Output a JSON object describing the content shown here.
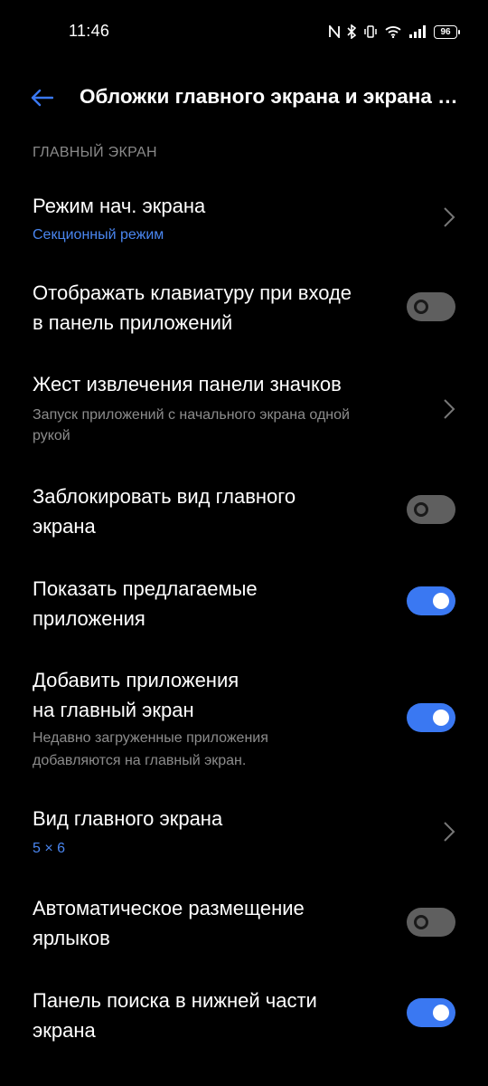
{
  "status_bar": {
    "time": "11:46",
    "battery": "96",
    "icons": [
      "nfc-icon",
      "bluetooth-icon",
      "vibrate-icon",
      "wifi-icon",
      "signal-icon",
      "battery-icon"
    ]
  },
  "header": {
    "title": "Обложки главного экрана и экрана блокировки"
  },
  "section": {
    "label": "ГЛАВНЫЙ ЭКРАН"
  },
  "settings": [
    {
      "title": "Режим нач. экрана",
      "subtitle": "Секционный режим",
      "control": "chevron"
    },
    {
      "title_lines": [
        "Отображать клавиатуру при входе",
        "в панель приложений"
      ],
      "control": "toggle",
      "state": "off"
    },
    {
      "title": "Жест извлечения панели значков",
      "subtitle_lines": [
        "Запуск приложений с начального экрана одной",
        "рукой"
      ],
      "control": "chevron"
    },
    {
      "title_lines": [
        "Заблокировать вид главного",
        "экрана"
      ],
      "control": "toggle",
      "state": "off"
    },
    {
      "title_lines": [
        "Показать предлагаемые",
        "приложения"
      ],
      "control": "toggle",
      "state": "on"
    },
    {
      "title_lines": [
        "Добавить приложения",
        "на главный экран"
      ],
      "subtitle_lines": [
        "Недавно загруженные приложения",
        "добавляются на главный экран."
      ],
      "control": "toggle",
      "state": "on"
    },
    {
      "title": "Вид главного экрана",
      "subtitle": "5 × 6",
      "control": "chevron"
    },
    {
      "title_lines": [
        "Автоматическое размещение",
        "ярлыков"
      ],
      "control": "toggle",
      "state": "off"
    },
    {
      "title_lines": [
        "Панель поиска в нижней части",
        "экрана"
      ],
      "control": "toggle",
      "state": "on"
    }
  ],
  "colors": {
    "accent": "#3a78f2",
    "link": "#4a86f0",
    "toggle_off": "#5f5f5f",
    "background": "#000000",
    "secondary_text": "#8c8c8c"
  }
}
